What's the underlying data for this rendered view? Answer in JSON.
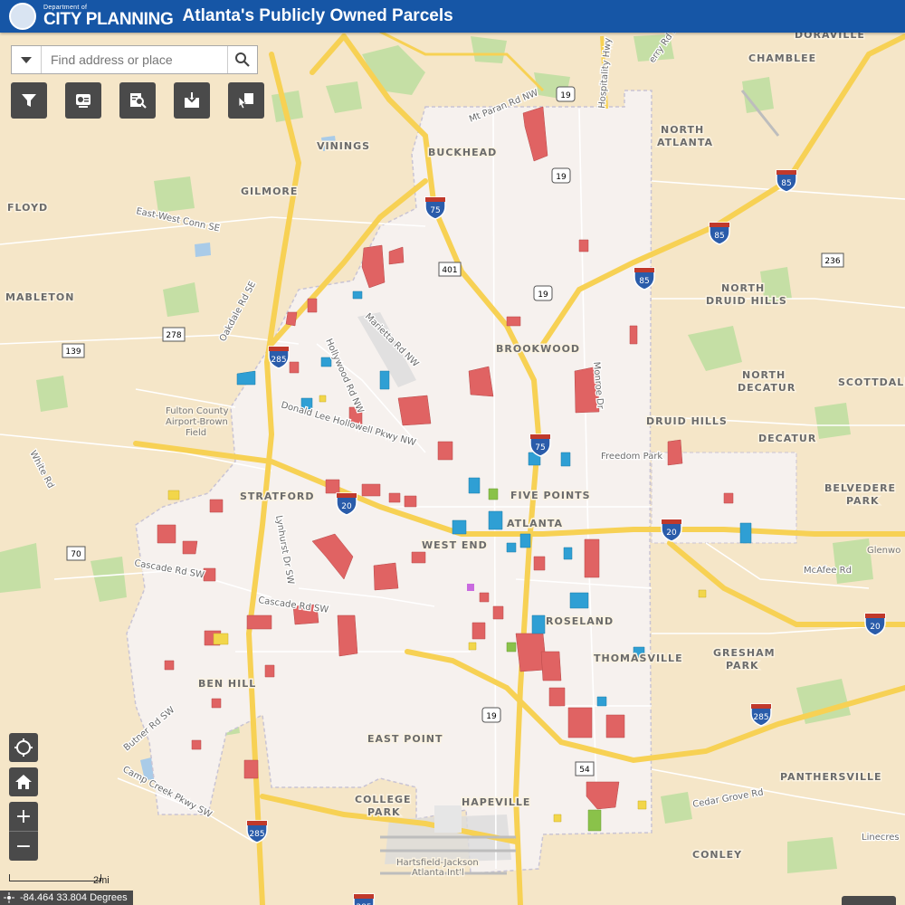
{
  "header": {
    "dept_line": "Department of",
    "dept_name": "CITY PLANNING",
    "title": "Atlanta's Publicly Owned Parcels"
  },
  "search": {
    "placeholder": "Find address or place"
  },
  "tools": [
    {
      "name": "filter-icon"
    },
    {
      "name": "layer-list-icon"
    },
    {
      "name": "query-icon"
    },
    {
      "name": "print-icon"
    },
    {
      "name": "select-icon"
    }
  ],
  "nav": {
    "zoom_in": "+",
    "zoom_out": "−"
  },
  "scale": {
    "label": "2mi"
  },
  "coordinates": {
    "text": "-84.464 33.804 Degrees"
  },
  "places": {
    "doraville": "DORAVILLE",
    "chamblee": "CHAMBLEE",
    "vinings": "VININGS",
    "buckhead": "BUCKHEAD",
    "north_atlanta_1": "NORTH",
    "north_atlanta_2": "ATLANTA",
    "gilmore": "GILMORE",
    "floyd": "FLOYD",
    "mableton": "MABLETON",
    "north_druid_1": "NORTH",
    "north_druid_2": "DRUID HILLS",
    "brookwood": "BROOKWOOD",
    "north_decatur_1": "NORTH",
    "north_decatur_2": "DECATUR",
    "scottdale": "SCOTTDALE",
    "druid_hills": "DRUID HILLS",
    "decatur": "DECATUR",
    "stratford": "STRATFORD",
    "five_points": "FIVE POINTS",
    "atlanta": "ATLANTA",
    "belvedere_1": "BELVEDERE",
    "belvedere_2": "PARK",
    "west_end": "WEST END",
    "glenwood": "Glenwo",
    "roseland": "ROSELAND",
    "thomasville": "THOMASVILLE",
    "gresham_1": "GRESHAM",
    "gresham_2": "PARK",
    "ben_hill": "BEN HILL",
    "east_point": "EAST POINT",
    "panthersville": "PANTHERSVILLE",
    "college_park_1": "COLLEGE",
    "college_park_2": "PARK",
    "hapeville": "HAPEVILLE",
    "conley": "CONLEY",
    "airport_brown_1": "Fulton County",
    "airport_brown_2": "Airport-Brown",
    "airport_brown_3": "Field",
    "hartsfield_1": "Hartsfield-Jackson",
    "hartsfield_2": "Atlanta Int'l"
  },
  "roads": {
    "mt_paran": "Mt Paran Rd NW",
    "hospitality": "Hospitality Hwy",
    "east_west_conn": "East-West Conn SE",
    "oakdale": "Oakdale Rd SE",
    "marietta": "Marietta Rd NW",
    "hollywood": "Hollywood Rd NW",
    "donald_lee": "Donald Lee Hollowell Pkwy NW",
    "white": "White Rd",
    "lynhurst": "Lynhurst Dr SW",
    "cascade1": "Cascade Rd SW",
    "cascade2": "Cascade Rd SW",
    "butner": "Butner Rd SW",
    "camp_creek": "Camp Creek Pkwy SW",
    "mcafee": "McAfee Rd",
    "cedar_grove": "Cedar Grove Rd",
    "linecrest": "Linecres",
    "freedom_park": "Freedom Park",
    "ferry": "erry Rd NE",
    "monroe": "Monroe Dr"
  },
  "shields": {
    "i285_nw": "285",
    "i75_n": "75",
    "i85_ne": "85",
    "i85_ne2": "85",
    "i85_c": "85",
    "i20_w": "20",
    "i75_c": "75",
    "i20_e": "20",
    "i20_se": "20",
    "i285_se": "285",
    "i285_s": "285",
    "i285_sw": "285",
    "us19_n": "19",
    "us19_2": "19",
    "us19_3": "19",
    "us19_s": "19",
    "sr401": "401",
    "sr236": "236",
    "sr278": "278",
    "sr139": "139",
    "sr70": "70",
    "sr54": "54"
  },
  "colors": {
    "city_owned": "#e06363",
    "school_owned": "#2f9fd4",
    "other_owned": "#f2d64a",
    "county_owned": "#8ac24a",
    "highway": "#f7d154",
    "base": "#f5e6c8",
    "city_boundary": "#f6f1ee"
  }
}
